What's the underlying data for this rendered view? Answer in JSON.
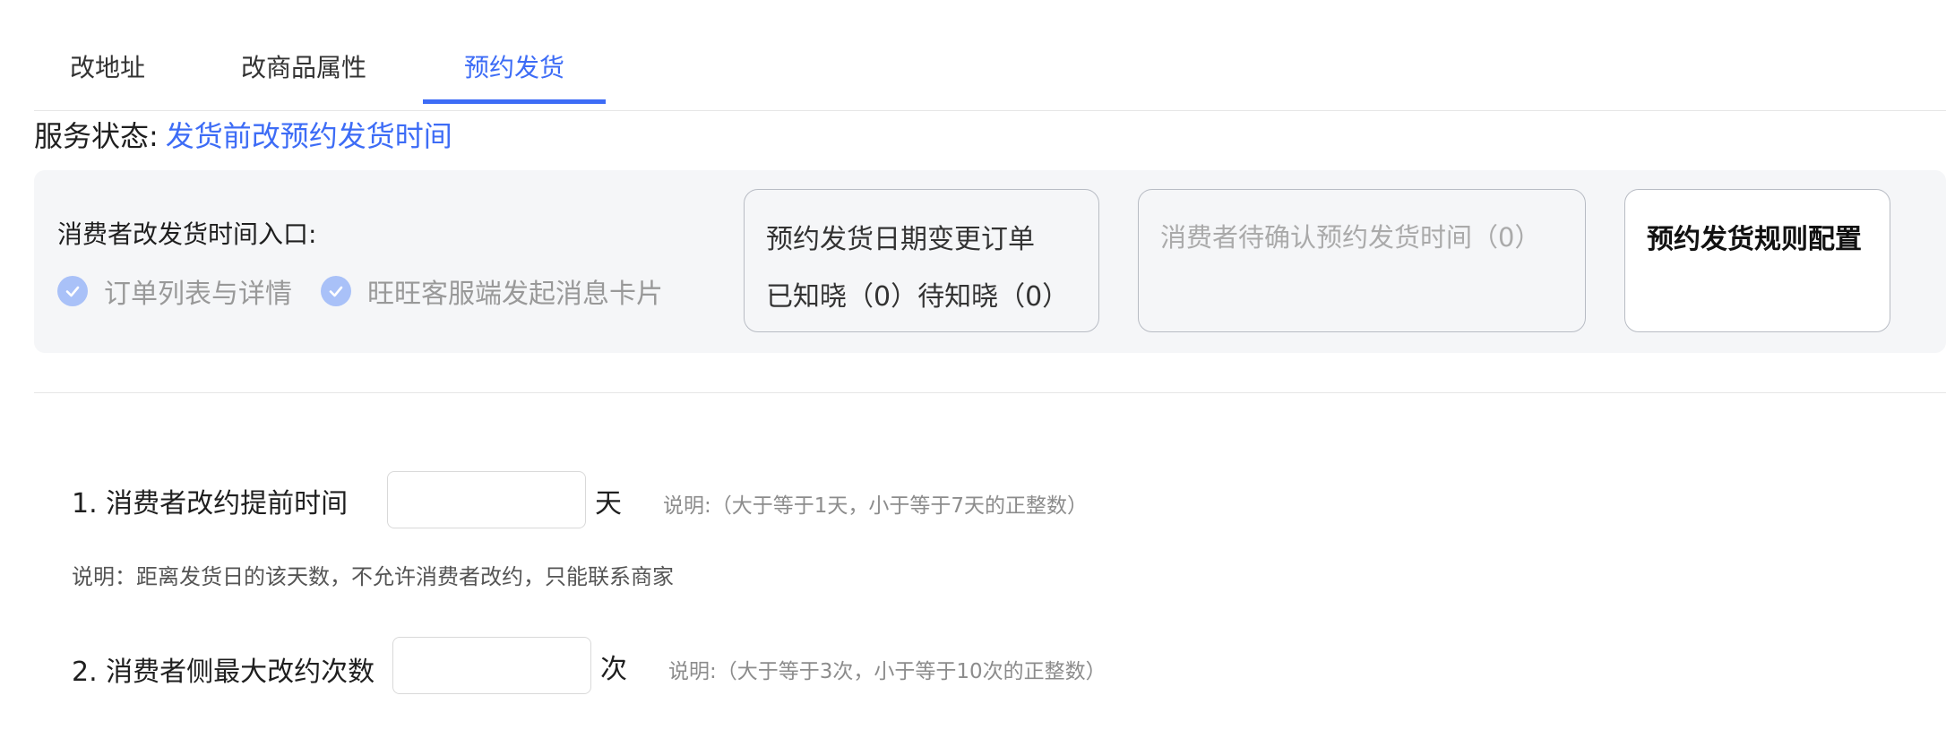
{
  "tabs": [
    {
      "label": "改地址"
    },
    {
      "label": "改商品属性"
    },
    {
      "label": "预约发货",
      "active": true
    }
  ],
  "status": {
    "label": "服务状态:",
    "value": "发货前改预约发货时间"
  },
  "entry": {
    "title": "消费者改发货时间入口:",
    "items": [
      {
        "label": "订单列表与详情",
        "icon": "check-circle-icon"
      },
      {
        "label": "旺旺客服端发起消息卡片",
        "icon": "check-circle-icon"
      }
    ]
  },
  "cards": [
    {
      "title": "预约发货日期变更订单",
      "subtitle": "已知晓（0）待知晓（0）"
    },
    {
      "title": "消费者待确认预约发货时间（0）"
    },
    {
      "title": "预约发货规则配置"
    }
  ],
  "form": {
    "rule1": {
      "label": "1. 消费者改约提前时间",
      "value": "",
      "unit": "天",
      "hint": "说明:（大于等于1天，小于等于7天的正整数）",
      "note": "说明：距离发货日的该天数，不允许消费者改约，只能联系商家"
    },
    "rule2": {
      "label": "2. 消费者侧最大改约次数",
      "value": "",
      "unit": "次",
      "hint": "说明:（大于等于3次，小于等于10次的正整数）"
    }
  },
  "colors": {
    "accent": "#3d6cf6",
    "check": "#a9c1f8",
    "panel": "#f5f6f8"
  }
}
